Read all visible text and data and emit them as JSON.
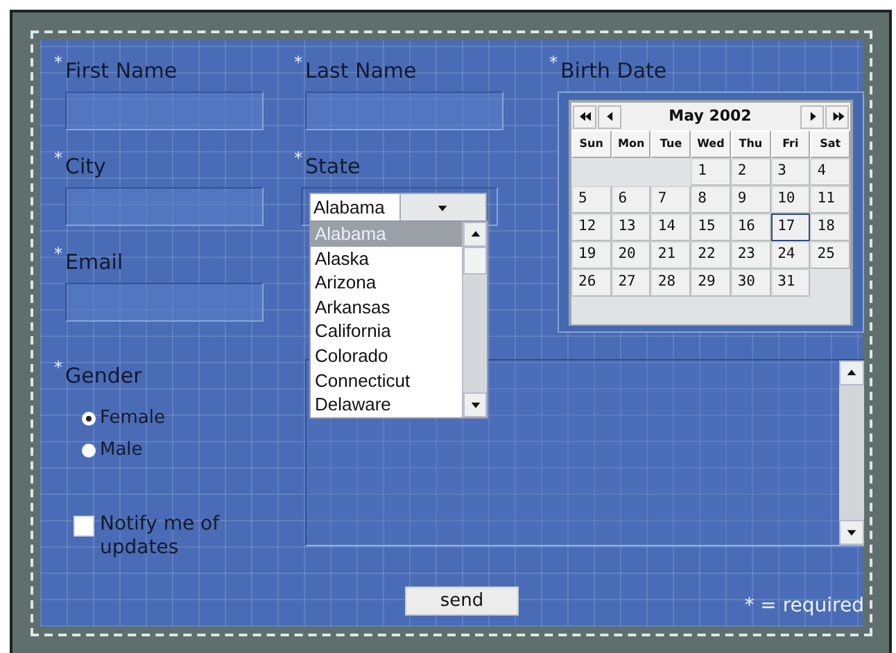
{
  "first_name": {
    "marker": "*",
    "label": "First Name"
  },
  "last_name": {
    "marker": "*",
    "label": "Last Name"
  },
  "birth_date": {
    "marker": "*",
    "label": "Birth Date"
  },
  "city": {
    "marker": "*",
    "label": "City"
  },
  "state": {
    "marker": "*",
    "label": "State",
    "value": "Alabama",
    "expanded": true,
    "options": [
      {
        "label": "Alabama",
        "selected": true
      },
      {
        "label": "Alaska",
        "selected": false
      },
      {
        "label": "Arizona",
        "selected": false
      },
      {
        "label": "Arkansas",
        "selected": false
      },
      {
        "label": "California",
        "selected": false
      },
      {
        "label": "Colorado",
        "selected": false
      },
      {
        "label": "Connecticut",
        "selected": false
      },
      {
        "label": "Delaware",
        "selected": false
      }
    ]
  },
  "email": {
    "marker": "*",
    "label": "Email"
  },
  "gender": {
    "marker": "*",
    "label": "Gender",
    "options": [
      {
        "label": "Female",
        "selected": true
      },
      {
        "label": "Male",
        "selected": false
      }
    ]
  },
  "notify": {
    "label": "Notify me of updates",
    "checked": false
  },
  "calendar": {
    "title": "May  2002",
    "day_names": [
      "Sun",
      "Mon",
      "Tue",
      "Wed",
      "Thu",
      "Fri",
      "Sat"
    ],
    "weeks": [
      [
        {
          "kind": "blank"
        },
        {
          "kind": "blank"
        },
        {
          "kind": "blank"
        },
        {
          "day": "1",
          "selected": false
        },
        {
          "day": "2",
          "selected": false
        },
        {
          "day": "3",
          "selected": false
        },
        {
          "day": "4",
          "selected": false
        }
      ],
      [
        {
          "day": "5",
          "selected": false
        },
        {
          "day": "6",
          "selected": false
        },
        {
          "day": "7",
          "selected": false
        },
        {
          "day": "8",
          "selected": false
        },
        {
          "day": "9",
          "selected": false
        },
        {
          "day": "10",
          "selected": false
        },
        {
          "day": "11",
          "selected": false
        }
      ],
      [
        {
          "day": "12",
          "selected": false
        },
        {
          "day": "13",
          "selected": false
        },
        {
          "day": "14",
          "selected": false
        },
        {
          "day": "15",
          "selected": false
        },
        {
          "day": "16",
          "selected": false
        },
        {
          "day": "17",
          "selected": true
        },
        {
          "day": "18",
          "selected": false
        }
      ],
      [
        {
          "day": "19",
          "selected": false
        },
        {
          "day": "20",
          "selected": false
        },
        {
          "day": "21",
          "selected": false
        },
        {
          "day": "22",
          "selected": false
        },
        {
          "day": "23",
          "selected": false
        },
        {
          "day": "24",
          "selected": false
        },
        {
          "day": "25",
          "selected": false
        }
      ],
      [
        {
          "day": "26",
          "selected": false
        },
        {
          "day": "27",
          "selected": false
        },
        {
          "day": "28",
          "selected": false
        },
        {
          "day": "29",
          "selected": false
        },
        {
          "day": "30",
          "selected": false
        },
        {
          "day": "31",
          "selected": false
        },
        {
          "kind": "blank"
        }
      ]
    ]
  },
  "send_button": "send",
  "required_note": "* = required"
}
